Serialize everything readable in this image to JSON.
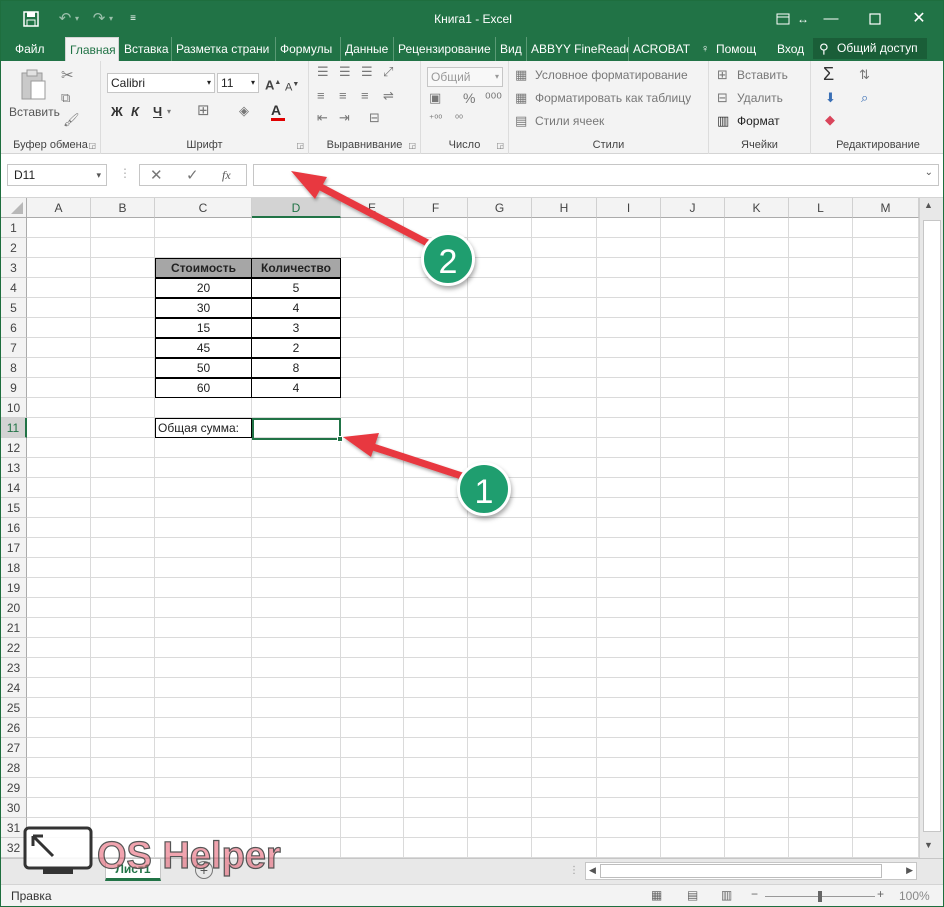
{
  "window": {
    "title": "Книга1 - Excel"
  },
  "menu": {
    "tabs": [
      "Файл",
      "Главная",
      "Вставка",
      "Разметка страни",
      "Формулы",
      "Данные",
      "Рецензирование",
      "Вид",
      "ABBYY FineReade",
      "ACROBAT",
      "Помощ",
      "Вход"
    ],
    "share": "Общий доступ"
  },
  "ribbon": {
    "clipboard": {
      "paste": "Вставить",
      "label": "Буфер обмена"
    },
    "font": {
      "name": "Calibri",
      "size": "11",
      "bold": "Ж",
      "italic": "К",
      "underline": "Ч",
      "label": "Шрифт"
    },
    "alignment": {
      "label": "Выравнивание"
    },
    "number": {
      "format": "Общий",
      "label": "Число"
    },
    "styles": {
      "conditional": "Условное форматирование",
      "as_table": "Форматировать как таблицу",
      "cell_styles": "Стили ячеек",
      "label": "Стили"
    },
    "cells": {
      "insert": "Вставить",
      "delete": "Удалить",
      "format": "Формат",
      "label": "Ячейки"
    },
    "editing": {
      "label": "Редактирование"
    }
  },
  "formula_bar": {
    "name_box": "D11",
    "fx": "fx",
    "value": ""
  },
  "grid": {
    "columns": [
      "A",
      "B",
      "C",
      "D",
      "E",
      "F",
      "G",
      "H",
      "I",
      "J",
      "K",
      "L",
      "M"
    ],
    "rows": [
      "1",
      "2",
      "3",
      "4",
      "5",
      "6",
      "7",
      "8",
      "9",
      "10",
      "11",
      "12",
      "13",
      "14",
      "15",
      "16",
      "17",
      "18",
      "19",
      "20",
      "21",
      "22",
      "23",
      "24",
      "25",
      "26",
      "27",
      "28",
      "29",
      "30",
      "31",
      "32"
    ],
    "selected_cell": "D11",
    "table": {
      "headers": [
        "Стоимость",
        "Количество"
      ],
      "rows": [
        [
          "20",
          "5"
        ],
        [
          "30",
          "4"
        ],
        [
          "15",
          "3"
        ],
        [
          "45",
          "2"
        ],
        [
          "50",
          "8"
        ],
        [
          "60",
          "4"
        ]
      ],
      "total_label": "Общая сумма:"
    }
  },
  "sheets": {
    "active": "Лист1"
  },
  "status": {
    "mode": "Правка",
    "zoom": "100%"
  },
  "annotations": {
    "badge1": "1",
    "badge2": "2"
  },
  "watermark": {
    "text": "OS Helper"
  },
  "colors": {
    "excel_green": "#217346",
    "badge_green": "#1f9e6f",
    "arrow_red": "#e8393f",
    "header_gray": "#a6a6a6"
  }
}
